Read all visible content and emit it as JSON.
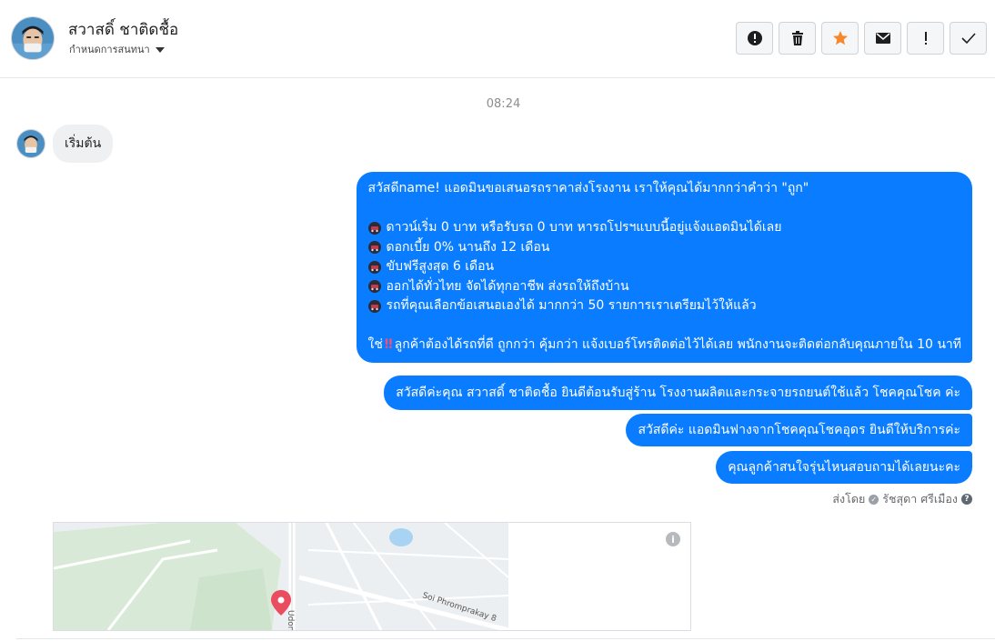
{
  "header": {
    "contact_name": "สวาสดิ์ ชาติดชื้อ",
    "status_label": "กำหนดการสนทนา",
    "avatar_icon": "user-avatar",
    "actions": [
      {
        "icon": "alert-circle-icon"
      },
      {
        "icon": "trash-icon"
      },
      {
        "icon": "star-icon",
        "color": "#f5882a"
      },
      {
        "icon": "envelope-icon"
      },
      {
        "icon": "exclamation-icon"
      },
      {
        "icon": "check-icon"
      }
    ]
  },
  "conversation": {
    "timestamp": "08:24",
    "incoming": [
      {
        "text": "เริ่มต้น"
      }
    ],
    "outgoing_main": {
      "lines": [
        "สวัสดีname! แอดมินขอเสนอรถราคาส่งโรงงาน เราให้คุณได้มากกว่าคำว่า \"ถูก\"",
        "",
        "ดาวน์เริ่ม 0 บาท หรือรับรถ 0 บาท หารถโปรฯแบบนี้อยู่แจ้งแอดมินได้เลย",
        "ดอกเบี้ย 0% นานถึง 12 เดือน",
        "ขับฟรีสูงสุด 6 เดือน",
        "ออกได้ทั่วไทย จัดได้ทุกอาชีพ ส่งรถให้ถึงบ้าน",
        "รถที่คุณเลือกข้อเสนอเองได้ มากกว่า 50 รายการเราเตรียมไว้ให้แล้ว",
        "",
        "ใช่",
        "ลูกค้าต้องได้รถที่ดี ถูกกว่า คุ้มกว่า แจ้งเบอร์โทรติดต่อไว้ได้เลย พนักงานจะติดต่อกลับคุณภายใน 10 นาที"
      ],
      "bullet_icon": "car-emoji-icon",
      "alarm_icon": "double-exclamation-icon"
    },
    "outgoing_followups": [
      "สวัสดีค่ะคุณ สวาสดิ์ ชาติดชื้อ ยินดีต้อนรับสู่ร้าน โรงงานผลิตและกระจายรถยนต์ใช้แล้ว โชคคุณโชค ค่ะ",
      "สวัสดีค่ะ แอดมินฟางจากโชคคุณโชคอุดร ยินดีให้บริการค่ะ",
      "คุณลูกค้าสนใจรุ่นไหนสอบถามได้เลยนะคะ"
    ],
    "sent_by_label": "ส่งโดย",
    "sent_by_name": "รัชสุดา ศรีเมือง",
    "bubble_color": "#0a7cff"
  },
  "map": {
    "labels": [
      "Soi Phromprakay 8",
      "Udon"
    ],
    "info_icon": "info-icon",
    "pin_icon": "map-pin-icon",
    "pin_color": "#e94d5f"
  }
}
